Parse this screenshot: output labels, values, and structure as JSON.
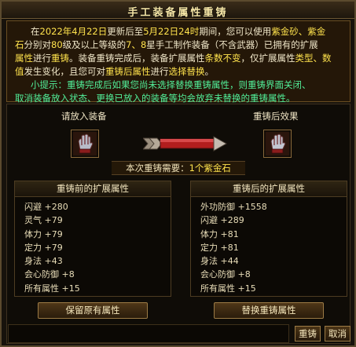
{
  "window": {
    "title": "手工装备属性重铸",
    "close_label": "×"
  },
  "notice": {
    "line1_a": "在",
    "line1_date1": "2022年4月22日",
    "line1_b": "更新后至",
    "line1_date2": "5月22日24时",
    "line1_c": "期间，您可以使用",
    "line1_item": "紫金砂、紫金",
    "line2_item": "石",
    "line2_a": "分别对",
    "line2_lv": "80",
    "line2_b": "级及以上等级的",
    "line2_star": "7、8",
    "line2_c": "星手工制作装备（不含武器）已拥有的扩展",
    "line3_hl": "属性",
    "line3_a": "进行",
    "line3_b": "重铸",
    "line3_c": "。装备重铸完成后，装备扩展属性",
    "line3_d": "条数不变",
    "line3_e": "，仅扩展属性",
    "line3_f": "类型、数",
    "line4_a": "值",
    "line4_b": "发生变化，且您可对",
    "line4_c": "重铸后属性",
    "line4_d": "进行",
    "line4_e": "选择替换",
    "line4_f": "。",
    "tip1": "小提示：重铸完成后如果您尚未选择替换重铸属性，则重铸界面关闭、",
    "tip2": "取消装备放入状态、更换已放入的装备等均会放弃未替换的重铸属性。"
  },
  "left_slot": {
    "label": "请放入装备",
    "icon": "gauntlet-icon"
  },
  "right_slot": {
    "label": "重铸后效果",
    "icon": "gauntlet-icon"
  },
  "cost": {
    "prefix": "本次重铸需要：",
    "amount": "1个紫金石"
  },
  "before": {
    "header": "重铸前的扩展属性",
    "rows": [
      "闪避 +280",
      "灵气 +79",
      "体力 +79",
      "定力 +79",
      "身法 +43",
      "会心防御 +8",
      "所有属性 +15"
    ]
  },
  "after": {
    "header": "重铸后的扩展属性",
    "rows": [
      "外功防御 +1558",
      "闪避 +289",
      "体力 +81",
      "定力 +81",
      "身法 +44",
      "会心防御 +8",
      "所有属性 +15"
    ]
  },
  "buttons": {
    "keep": "保留原有属性",
    "replace": "替换重铸属性",
    "reforge": "重铸",
    "cancel": "取消"
  },
  "colors": {
    "highlight": "#ffe34d",
    "tip": "#52f09a",
    "frame": "#9c7b45"
  }
}
